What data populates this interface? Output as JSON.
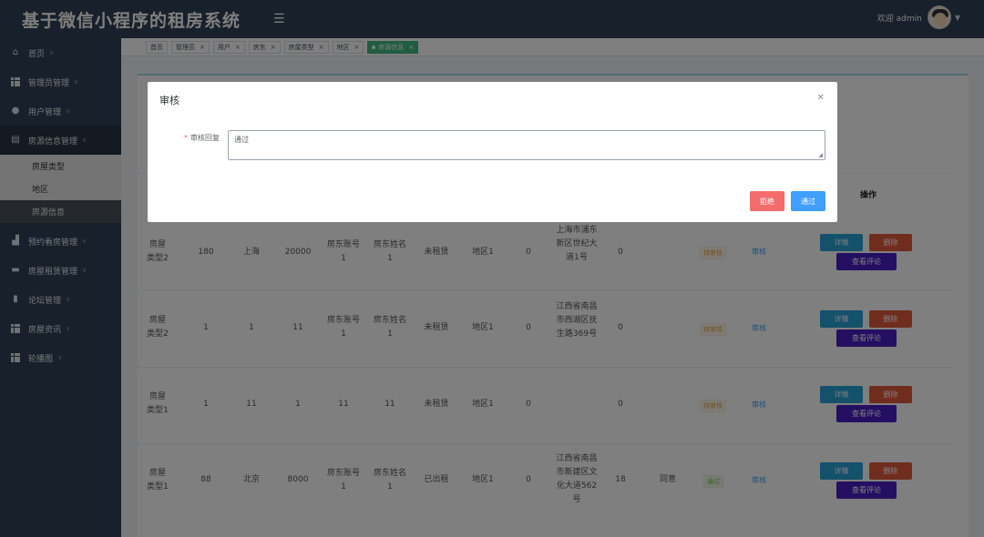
{
  "header": {
    "title": "基于微信小程序的租房系统",
    "welcome": "欢迎 admin"
  },
  "sidebar": {
    "items": [
      {
        "label": "首页",
        "icon": "home-icon"
      },
      {
        "label": "管理员管理",
        "icon": "grid-icon"
      },
      {
        "label": "用户管理",
        "icon": "user-icon"
      },
      {
        "label": "房源信息管理",
        "icon": "card-icon",
        "open": true
      },
      {
        "label": "预约看房管理",
        "icon": "building-icon"
      },
      {
        "label": "房屋租赁管理",
        "icon": "list-icon"
      },
      {
        "label": "论坛管理",
        "icon": "book-icon"
      },
      {
        "label": "房屋资讯",
        "icon": "grid-icon"
      },
      {
        "label": "轮播图",
        "icon": "grid-icon"
      }
    ],
    "submenu": [
      "房屋类型",
      "地区",
      "房源信息"
    ]
  },
  "tags": [
    {
      "label": "首页",
      "closable": false
    },
    {
      "label": "管理员",
      "closable": true
    },
    {
      "label": "用户",
      "closable": true
    },
    {
      "label": "房东",
      "closable": true
    },
    {
      "label": "房屋类型",
      "closable": true
    },
    {
      "label": "地区",
      "closable": true
    },
    {
      "label": "房源信息",
      "closable": true,
      "active": true
    }
  ],
  "table": {
    "op_header": "操作",
    "rows": [
      {
        "type": "房屋类型2",
        "area": "180",
        "city": "上海",
        "price": "20000",
        "landlord_acct": "房东账号1",
        "landlord_name": "房东姓名1",
        "rent_status": "未租赁",
        "region": "地区1",
        "c1": "0",
        "address": "上海市浦东新区世纪大道1号",
        "c2": "0",
        "reply": "",
        "audit": "待审核",
        "audit_state": "pending"
      },
      {
        "type": "房屋类型2",
        "area": "1",
        "city": "1",
        "price": "11",
        "landlord_acct": "房东账号1",
        "landlord_name": "房东姓名1",
        "rent_status": "未租赁",
        "region": "地区1",
        "c1": "0",
        "address": "江西省南昌市西湖区抚生路369号",
        "c2": "0",
        "reply": "",
        "audit": "待审核",
        "audit_state": "pending"
      },
      {
        "type": "房屋类型1",
        "area": "1",
        "city": "11",
        "price": "1",
        "landlord_acct": "11",
        "landlord_name": "11",
        "rent_status": "未租赁",
        "region": "地区1",
        "c1": "0",
        "address": "",
        "c2": "0",
        "reply": "",
        "audit": "待审核",
        "audit_state": "pending"
      },
      {
        "type": "房屋类型1",
        "area": "88",
        "city": "北京",
        "price": "8000",
        "landlord_acct": "房东账号1",
        "landlord_name": "房东姓名1",
        "rent_status": "已出租",
        "region": "地区1",
        "c1": "0",
        "address": "江西省南昌市新建区文化大道562号",
        "c2": "18",
        "reply": "同意",
        "audit": "通过",
        "audit_state": "pass"
      }
    ],
    "actions": {
      "review": "审核",
      "detail": "详情",
      "delete": "删除",
      "comments": "查看评论"
    }
  },
  "dialog": {
    "title": "审核",
    "field_label": "审核回复",
    "field_value": "通过",
    "reject": "拒绝",
    "pass": "通过"
  }
}
